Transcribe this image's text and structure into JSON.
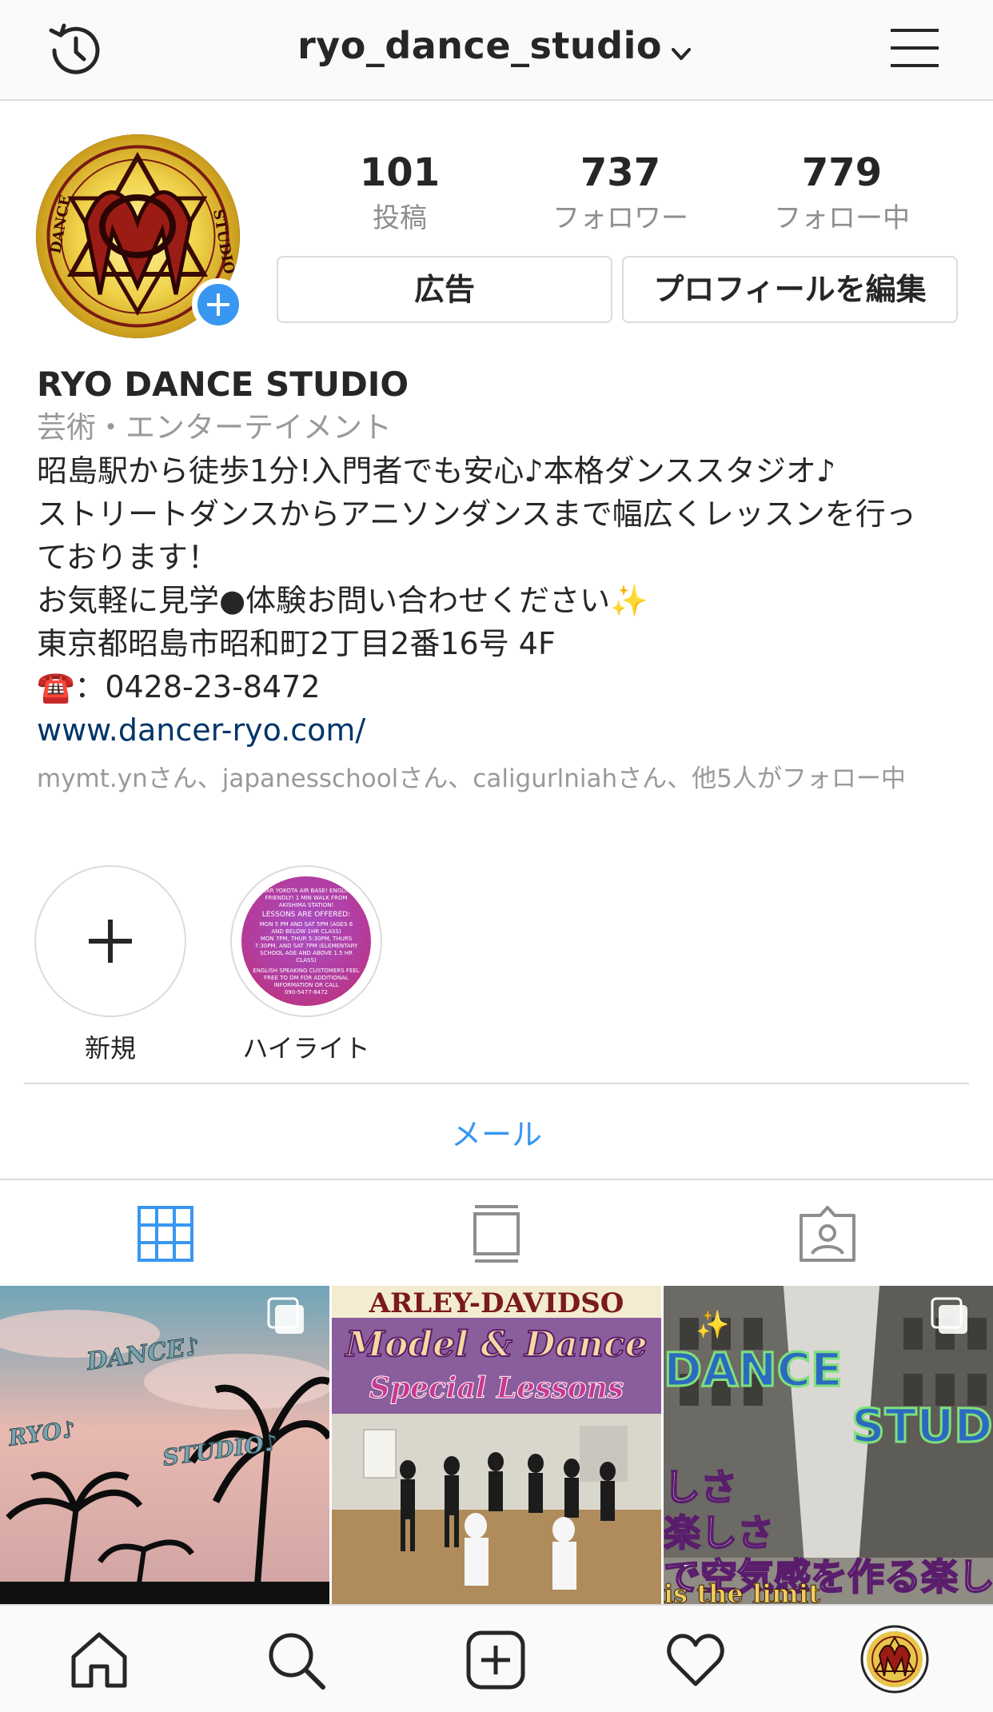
{
  "header": {
    "username": "ryo_dance_studio",
    "history_icon": "history-icon",
    "menu_icon": "hamburger-menu-icon"
  },
  "profile": {
    "stats": [
      {
        "value": "101",
        "label": "投稿"
      },
      {
        "value": "737",
        "label": "フォロワー"
      },
      {
        "value": "779",
        "label": "フォロー中"
      }
    ],
    "buttons": {
      "ad": "広告",
      "edit": "プロフィールを編集"
    },
    "name": "RYO DANCE STUDIO",
    "category": "芸術・エンターテイメント",
    "bio_lines": [
      "昭島駅から徒歩1分!入門者でも安心♪本格ダンススタジオ♪",
      "ストリートダンスからアニソンダンスまで幅広くレッスンを行っ",
      "ております！",
      "お気軽に見学●体験お問い合わせください✨",
      "東京都昭島市昭和町2丁目2番16号 4F",
      "☎️：0428-23-8472"
    ],
    "link": "www.dancer-ryo.com/",
    "followed_by": "mymt.ynさん、japanesschoolさん、caligurlniahさん、他5人がフォロー中"
  },
  "highlights": [
    {
      "label": "新規"
    },
    {
      "label": "ハイライト"
    }
  ],
  "highlight_image_text": [
    "NEAR YOKOTA AIR BASE! ENGLISH",
    "FRIENDLY! 1 MIN WALK FROM",
    "AKISHIMA STATION!",
    "LESSONS ARE OFFERED:",
    "MON 5 PM AND SAT 5PM (AGES 6",
    "AND BELOW 1HR CLASS)",
    "MON 7PM, THUR 5:30PM, THURS",
    "7:30PM, AND SAT 7PM (ELEMENTARY",
    "SCHOOL AGE AND ABOVE 1.5 HR",
    "CLASS)",
    "ENGLISH SPEAKING CUSTOMERS FEEL",
    "FREE TO DM FOR ADDITIONAL",
    "INFORMATION OR CALL",
    "090-5477-8472"
  ],
  "contact": {
    "mail": "メール"
  },
  "posts": [
    {
      "texts": [
        "DANCE♪",
        "RYO♪",
        "STUDIO♪"
      ]
    },
    {
      "texts": [
        "ARLEY-DAVIDSO",
        "Model & Dance",
        "Special Lessons"
      ]
    },
    {
      "texts": [
        "DANCE",
        "STUD",
        "しさ",
        "楽しさ",
        "で空気感を作る楽し",
        "is the limit"
      ]
    }
  ],
  "colors": {
    "accent": "#3897f0",
    "link": "#003569",
    "secondary_text": "#999999",
    "border": "#dbdbdb"
  }
}
